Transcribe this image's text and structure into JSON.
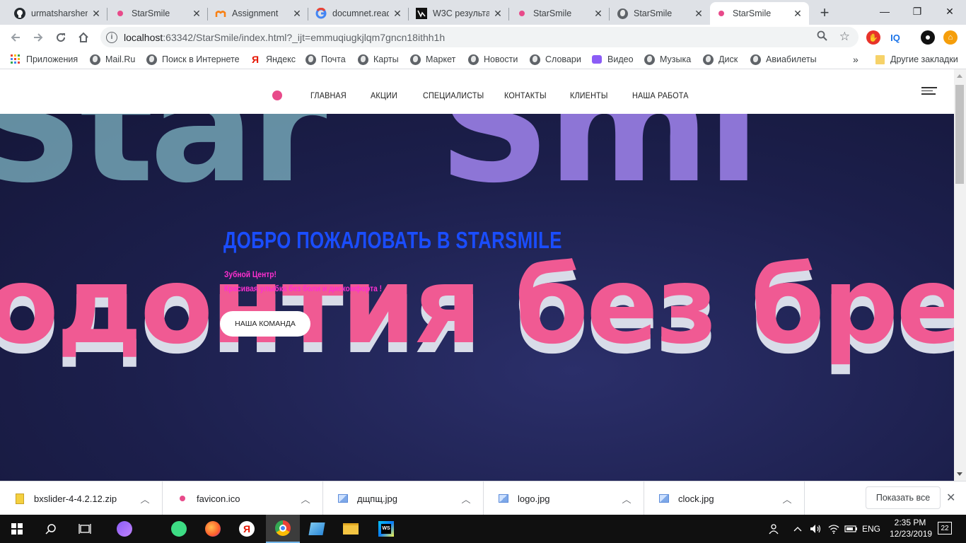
{
  "browser": {
    "tabs": [
      {
        "title": "urmatsharshen",
        "icon": "github-icon"
      },
      {
        "title": "StarSmile",
        "icon": "pink-dot-icon"
      },
      {
        "title": "Assignment",
        "icon": "moodle-icon"
      },
      {
        "title": "documnet.read",
        "icon": "google-icon"
      },
      {
        "title": "W3C результа",
        "icon": "w3c-icon"
      },
      {
        "title": "StarSmile",
        "icon": "pink-dot-icon"
      },
      {
        "title": "StarSmile",
        "icon": "globe-icon"
      },
      {
        "title": "StarSmile",
        "icon": "pink-dot-icon",
        "active": true
      }
    ],
    "close_glyph": "✕",
    "new_tab_glyph": "+",
    "window": {
      "minimize": "—",
      "maximize": "❐",
      "close": "✕"
    },
    "url_host": "localhost",
    "url_rest": ":63342/StarSmile/index.html?_ijt=emmuqiugkjlqm7gncn18ithh1h",
    "info_glyph": "i",
    "ext_iq": "IQ"
  },
  "bookmarks": {
    "apps": "Приложения",
    "items": [
      "Mail.Ru",
      "Поиск в Интернете",
      "Яндекс",
      "Почта",
      "Карты",
      "Маркет",
      "Новости",
      "Словари",
      "Видео",
      "Музыка",
      "Диск",
      "Авиабилеты"
    ],
    "more": "»",
    "other": "Другие закладки"
  },
  "site": {
    "nav": [
      "ГЛАВНАЯ",
      "АКЦИИ",
      "СПЕЦИАЛИСТЫ",
      "КОНТАКТЫ",
      "КЛИЕНТЫ",
      "НАША РАБОТА"
    ],
    "hero_title": "ДОБРО ПОЖАЛОВАТЬ В STARSMILE",
    "hero_line1": "Зубной Центр!",
    "hero_line2": "Красивая улыбка без боли и дискомфорта !",
    "cta": "НАША КОМАНДА",
    "bg_text_top_left": "Star",
    "bg_text_top_right": "Smi",
    "bg_text_bottom": "одонтия без бре",
    "colors": {
      "title": "#1a4dff",
      "subtitle": "#ff2fd0",
      "logo": "#e84a8a"
    }
  },
  "downloads": {
    "files": [
      "bxslider-4-4.2.12.zip",
      "favicon.ico",
      "дщпщ.jpg",
      "logo.jpg",
      "clock.jpg"
    ],
    "chevron": "︿",
    "show_all": "Показать все",
    "close": "✕"
  },
  "taskbar": {
    "lang": "ENG",
    "time": "2:35 PM",
    "date": "12/23/2019",
    "notifications": "22"
  }
}
